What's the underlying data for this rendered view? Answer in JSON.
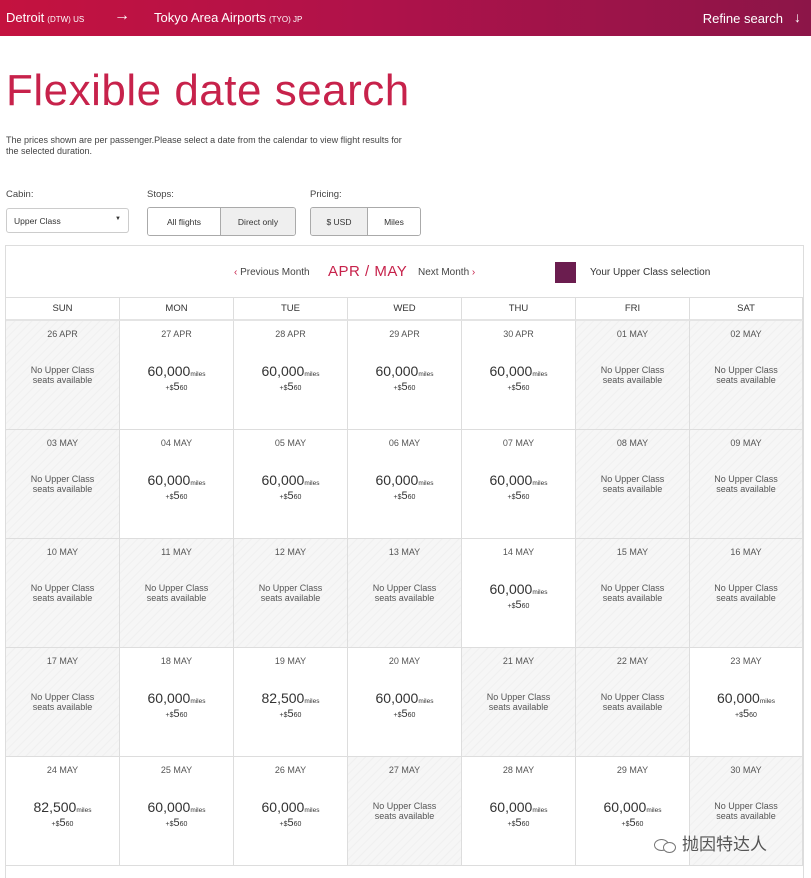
{
  "header": {
    "origin_city": "Detroit",
    "origin_code": "(DTW) US",
    "arrow": "→",
    "destination_city": "Tokyo Area Airports",
    "destination_code": "(TYO) JP",
    "refine_label": "Refine search",
    "refine_icon": "↓"
  },
  "page": {
    "title": "Flexible date search",
    "description": "The prices shown are per passenger.Please select a date from the calendar to view flight results for the selected duration."
  },
  "filters": {
    "cabin_label": "Cabin:",
    "cabin_value": "Upper Class",
    "stops_label": "Stops:",
    "stops_options": [
      "All flights",
      "Direct only"
    ],
    "stops_selected": "Direct only",
    "pricing_label": "Pricing:",
    "pricing_options": [
      "$ USD",
      "Miles"
    ],
    "pricing_selected": "$ USD"
  },
  "calendar": {
    "prev_label": "Previous Month",
    "next_label": "Next Month",
    "month_label": "APR / MAY",
    "legend_label": "Your Upper Class selection",
    "legend_color": "#6b1d4f",
    "accent_color": "#c7224b",
    "weekdays": [
      "SUN",
      "MON",
      "TUE",
      "WED",
      "THU",
      "FRI",
      "SAT"
    ],
    "no_seats_line1": "No Upper Class",
    "no_seats_line2": "seats available",
    "miles_unit": "miles",
    "tax_prefix": "+$",
    "weeks": [
      [
        {
          "date": "26 APR",
          "miles": null
        },
        {
          "date": "27 APR",
          "miles": "60,000",
          "tax_main": "5",
          "tax_small": "60"
        },
        {
          "date": "28 APR",
          "miles": "60,000",
          "tax_main": "5",
          "tax_small": "60"
        },
        {
          "date": "29 APR",
          "miles": "60,000",
          "tax_main": "5",
          "tax_small": "60"
        },
        {
          "date": "30 APR",
          "miles": "60,000",
          "tax_main": "5",
          "tax_small": "60"
        },
        {
          "date": "01 MAY",
          "miles": null
        },
        {
          "date": "02 MAY",
          "miles": null
        }
      ],
      [
        {
          "date": "03 MAY",
          "miles": null
        },
        {
          "date": "04 MAY",
          "miles": "60,000",
          "tax_main": "5",
          "tax_small": "60"
        },
        {
          "date": "05 MAY",
          "miles": "60,000",
          "tax_main": "5",
          "tax_small": "60"
        },
        {
          "date": "06 MAY",
          "miles": "60,000",
          "tax_main": "5",
          "tax_small": "60"
        },
        {
          "date": "07 MAY",
          "miles": "60,000",
          "tax_main": "5",
          "tax_small": "60"
        },
        {
          "date": "08 MAY",
          "miles": null
        },
        {
          "date": "09 MAY",
          "miles": null
        }
      ],
      [
        {
          "date": "10 MAY",
          "miles": null
        },
        {
          "date": "11 MAY",
          "miles": null
        },
        {
          "date": "12 MAY",
          "miles": null
        },
        {
          "date": "13 MAY",
          "miles": null
        },
        {
          "date": "14 MAY",
          "miles": "60,000",
          "tax_main": "5",
          "tax_small": "60"
        },
        {
          "date": "15 MAY",
          "miles": null
        },
        {
          "date": "16 MAY",
          "miles": null
        }
      ],
      [
        {
          "date": "17 MAY",
          "miles": null
        },
        {
          "date": "18 MAY",
          "miles": "60,000",
          "tax_main": "5",
          "tax_small": "60"
        },
        {
          "date": "19 MAY",
          "miles": "82,500",
          "tax_main": "5",
          "tax_small": "60"
        },
        {
          "date": "20 MAY",
          "miles": "60,000",
          "tax_main": "5",
          "tax_small": "60"
        },
        {
          "date": "21 MAY",
          "miles": null
        },
        {
          "date": "22 MAY",
          "miles": null
        },
        {
          "date": "23 MAY",
          "miles": "60,000",
          "tax_main": "5",
          "tax_small": "60"
        }
      ],
      [
        {
          "date": "24 MAY",
          "miles": "82,500",
          "tax_main": "5",
          "tax_small": "60"
        },
        {
          "date": "25 MAY",
          "miles": "60,000",
          "tax_main": "5",
          "tax_small": "60"
        },
        {
          "date": "26 MAY",
          "miles": "60,000",
          "tax_main": "5",
          "tax_small": "60"
        },
        {
          "date": "27 MAY",
          "miles": null
        },
        {
          "date": "28 MAY",
          "miles": "60,000",
          "tax_main": "5",
          "tax_small": "60"
        },
        {
          "date": "29 MAY",
          "miles": "60,000",
          "tax_main": "5",
          "tax_small": "60"
        },
        {
          "date": "30 MAY",
          "miles": null
        }
      ]
    ]
  },
  "watermark": {
    "icon": "wechat-icon",
    "text": "抛因特达人"
  }
}
